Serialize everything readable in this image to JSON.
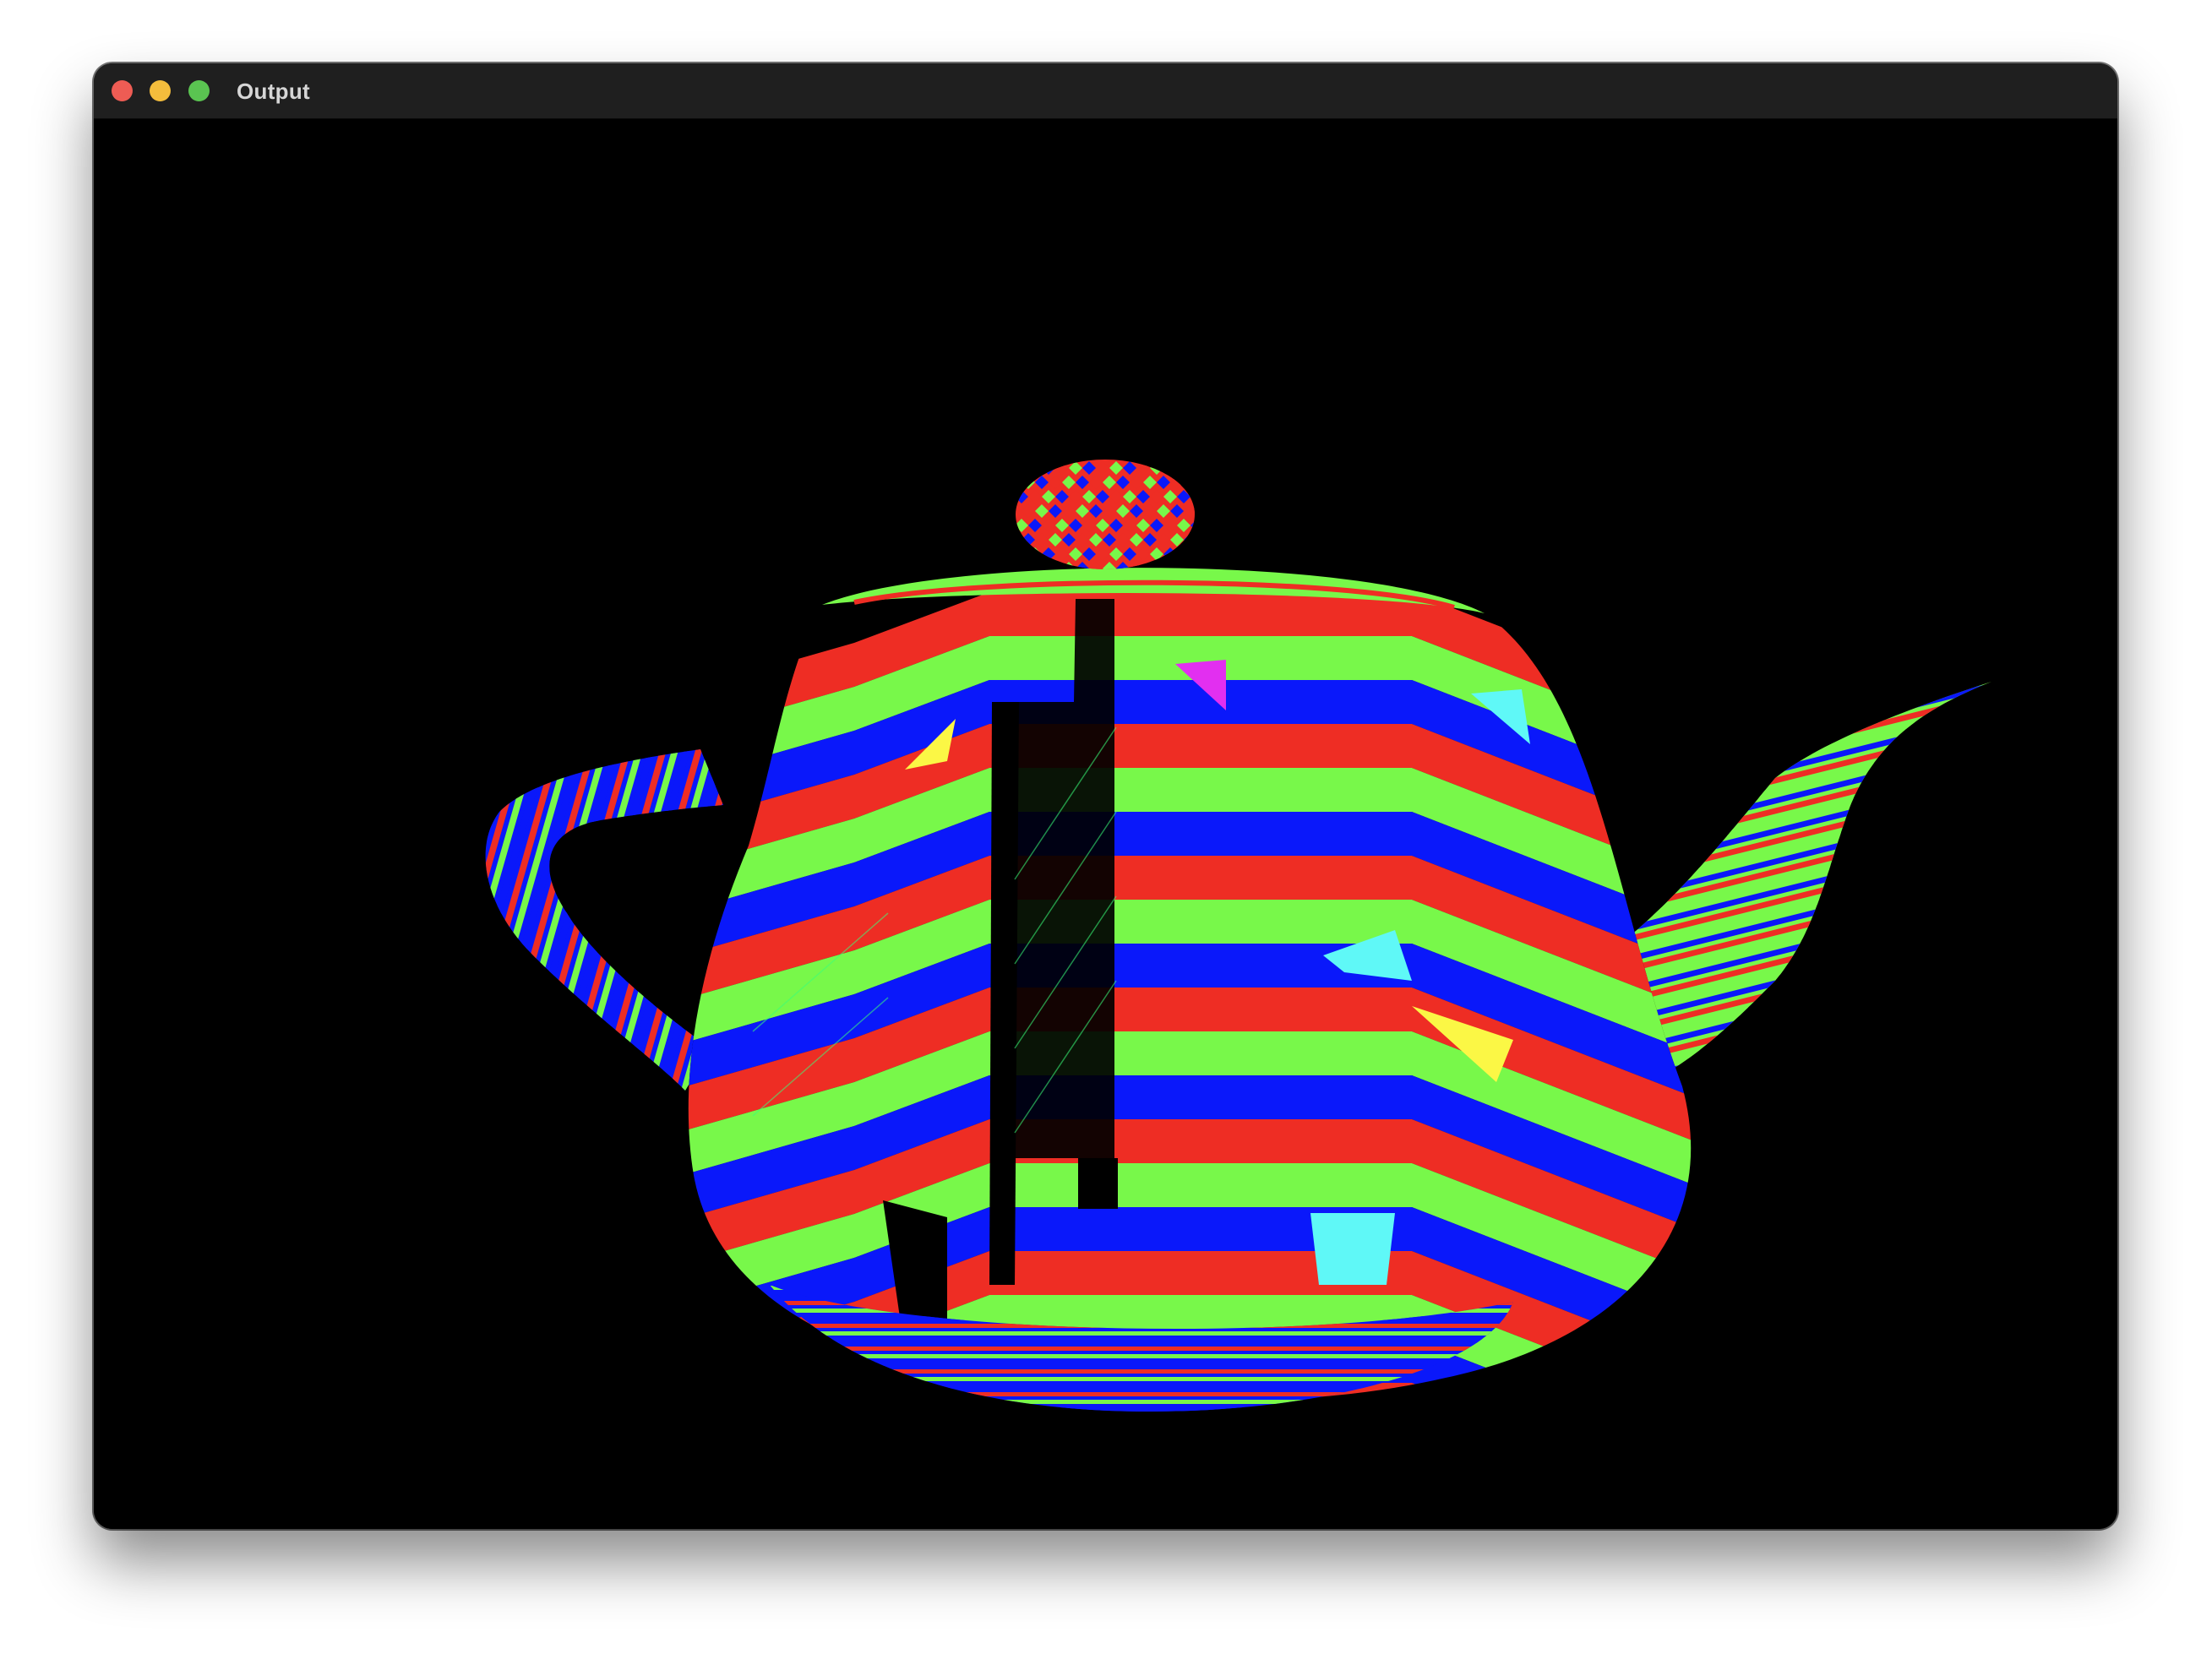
{
  "window": {
    "title": "Output"
  },
  "render": {
    "subject": "teapot",
    "background": "#000000",
    "stripe_colors": [
      "#ee2d24",
      "#78f84a",
      "#0a18fa",
      "#000000"
    ],
    "accent_colors": [
      "#fbf745",
      "#5ff8f7",
      "#e22ff0"
    ]
  }
}
